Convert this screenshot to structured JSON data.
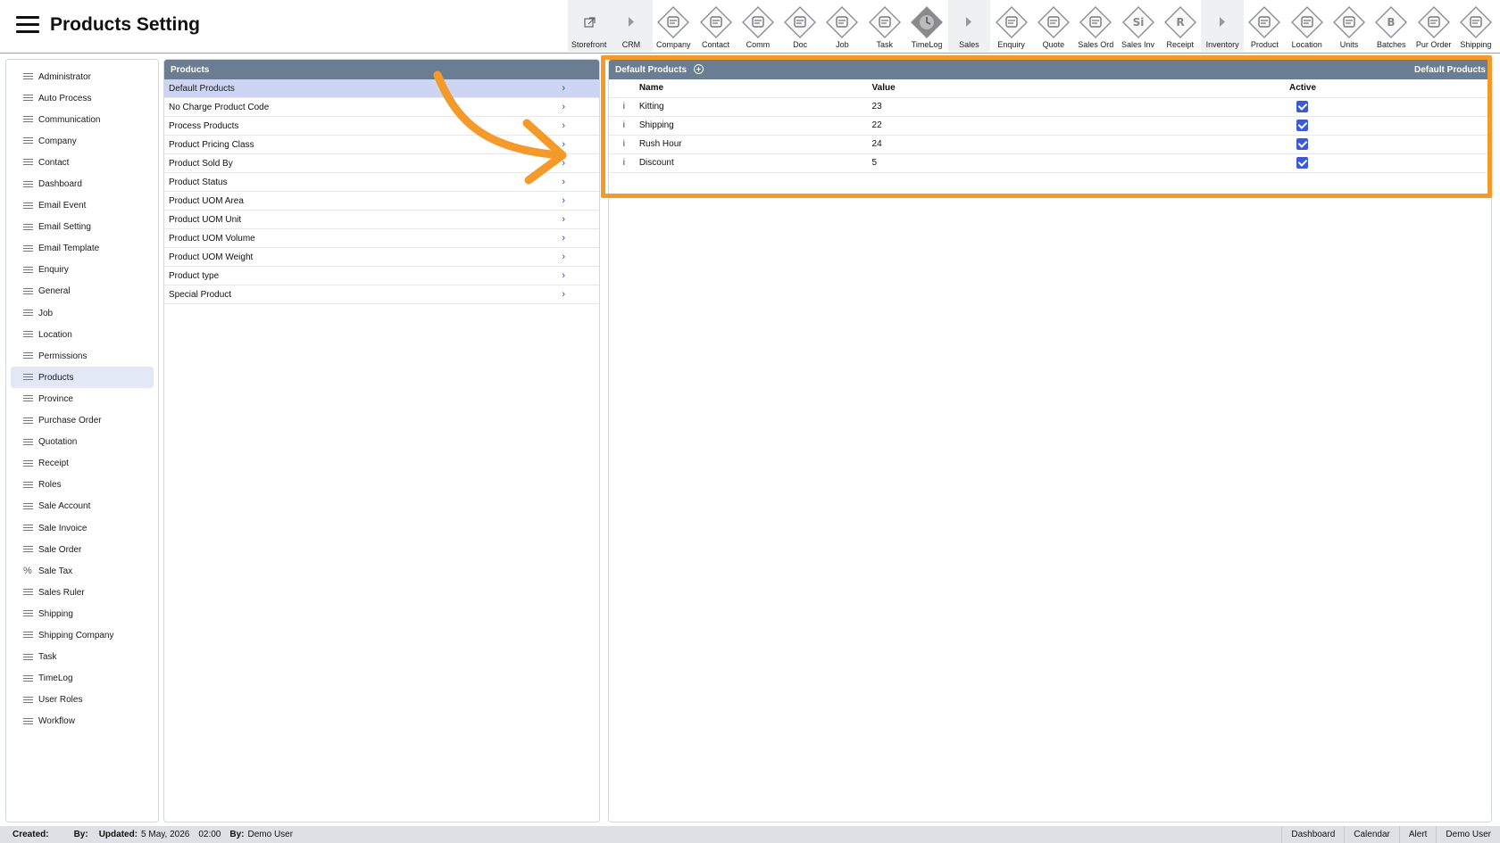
{
  "header": {
    "title": "Products Setting",
    "toolbar": [
      {
        "label": "Storefront",
        "icon": "external-link-icon",
        "plain": true
      },
      {
        "label": "CRM",
        "icon": "caret-right-icon",
        "plain": true
      },
      {
        "label": "Company",
        "icon": "company-icon"
      },
      {
        "label": "Contact",
        "icon": "contact-icon"
      },
      {
        "label": "Comm",
        "icon": "comm-icon"
      },
      {
        "label": "Doc",
        "icon": "doc-icon"
      },
      {
        "label": "Job",
        "icon": "job-icon"
      },
      {
        "label": "Task",
        "icon": "task-icon"
      },
      {
        "label": "TimeLog",
        "icon": "clock-icon"
      },
      {
        "label": "Sales",
        "icon": "caret-right-icon",
        "plain": true
      },
      {
        "label": "Enquiry",
        "icon": "enquiry-icon"
      },
      {
        "label": "Quote",
        "icon": "quote-icon"
      },
      {
        "label": "Sales Ord",
        "icon": "sales-order-icon"
      },
      {
        "label": "Sales Inv",
        "icon": "sales-invoice-icon",
        "glyph": "Si"
      },
      {
        "label": "Receipt",
        "icon": "receipt-icon",
        "glyph": "R"
      },
      {
        "label": "Inventory",
        "icon": "caret-right-icon",
        "plain": true
      },
      {
        "label": "Product",
        "icon": "product-icon"
      },
      {
        "label": "Location",
        "icon": "location-icon"
      },
      {
        "label": "Units",
        "icon": "units-icon"
      },
      {
        "label": "Batches",
        "icon": "batches-icon",
        "glyph": "B"
      },
      {
        "label": "Pur Order",
        "icon": "cart-icon"
      },
      {
        "label": "Shipping",
        "icon": "truck-icon"
      }
    ]
  },
  "sidebar": {
    "items": [
      {
        "label": "Administrator"
      },
      {
        "label": "Auto Process"
      },
      {
        "label": "Communication"
      },
      {
        "label": "Company"
      },
      {
        "label": "Contact"
      },
      {
        "label": "Dashboard"
      },
      {
        "label": "Email Event"
      },
      {
        "label": "Email Setting"
      },
      {
        "label": "Email Template"
      },
      {
        "label": "Enquiry"
      },
      {
        "label": "General"
      },
      {
        "label": "Job"
      },
      {
        "label": "Location"
      },
      {
        "label": "Permissions"
      },
      {
        "label": "Products",
        "active": true
      },
      {
        "label": "Province"
      },
      {
        "label": "Purchase Order"
      },
      {
        "label": "Quotation"
      },
      {
        "label": "Receipt"
      },
      {
        "label": "Roles"
      },
      {
        "label": "Sale Account"
      },
      {
        "label": "Sale Invoice"
      },
      {
        "label": "Sale Order"
      },
      {
        "label": "Sale Tax",
        "icon": "percent-icon"
      },
      {
        "label": "Sales Ruler"
      },
      {
        "label": "Shipping"
      },
      {
        "label": "Shipping Company"
      },
      {
        "label": "Task"
      },
      {
        "label": "TimeLog"
      },
      {
        "label": "User Roles"
      },
      {
        "label": "Workflow"
      }
    ]
  },
  "middle": {
    "title": "Products",
    "items": [
      {
        "label": "Default Products",
        "active": true
      },
      {
        "label": "No Charge Product Code"
      },
      {
        "label": "Process Products"
      },
      {
        "label": "Product Pricing Class"
      },
      {
        "label": "Product Sold By"
      },
      {
        "label": "Product Status"
      },
      {
        "label": "Product UOM Area"
      },
      {
        "label": "Product UOM Unit"
      },
      {
        "label": "Product UOM Volume"
      },
      {
        "label": "Product UOM Weight"
      },
      {
        "label": "Product type"
      },
      {
        "label": "Special Product"
      }
    ]
  },
  "detail": {
    "title": "Default Products",
    "title_right": "Default Products",
    "columns": {
      "name": "Name",
      "value": "Value",
      "active": "Active"
    },
    "info_glyph": "i",
    "rows": [
      {
        "name": "Kitting",
        "value": "23",
        "active": true
      },
      {
        "name": "Shipping",
        "value": "22",
        "active": true
      },
      {
        "name": "Rush Hour",
        "value": "24",
        "active": true
      },
      {
        "name": "Discount",
        "value": "5",
        "active": true
      }
    ]
  },
  "footer": {
    "created_label": "Created:",
    "by_label": "By:",
    "updated_label": "Updated:",
    "updated_date": "5 May, 2026",
    "updated_time": "02:00",
    "by2_label": "By:",
    "by2_value": "Demo User",
    "buttons": [
      "Dashboard",
      "Calendar",
      "Alert",
      "Demo User"
    ]
  },
  "colors": {
    "header_bar": "#6b7d93",
    "accent_blue": "#3b5bd6",
    "highlight_orange": "#f39a2b",
    "active_row": "#cdd5f2"
  }
}
